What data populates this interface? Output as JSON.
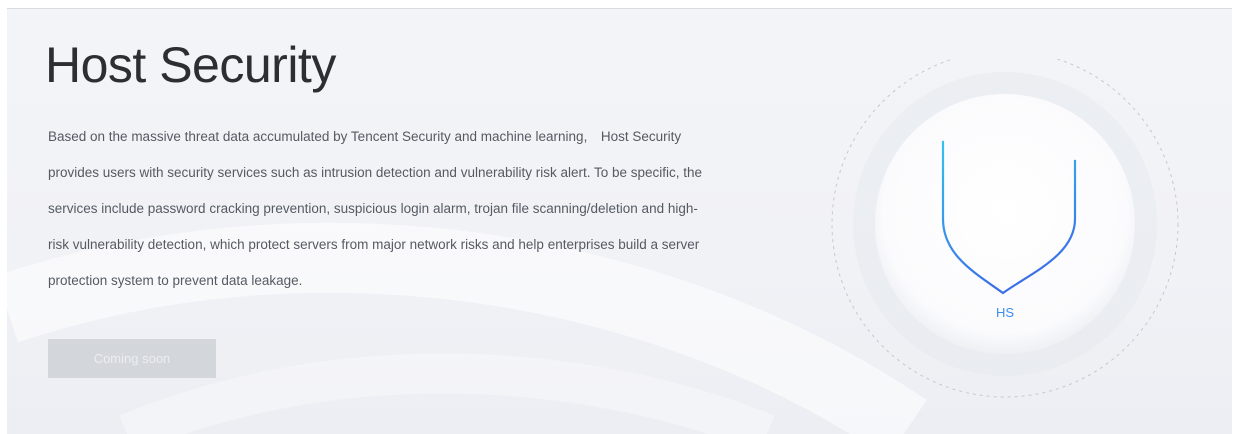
{
  "product": {
    "title": "Host Security",
    "description": "Based on the massive threat data accumulated by Tencent Security and machine learning,　Host Security provides users with security services such as intrusion detection and vulnerability risk alert. To be specific, the services include password cracking prevention, suspicious login alarm, trojan file scanning/deletion and high-risk vulnerability detection, which protect servers from major network risks and help enterprises build a server protection system to prevent data leakage.",
    "button_label": "Coming soon",
    "emblem_label": "HS"
  },
  "icons": {
    "emblem": "shield-server-icon"
  },
  "colors": {
    "accent": "#3d8ef0",
    "title": "#2b2e33",
    "text": "#555a62",
    "button_bg": "#d3d6db"
  }
}
